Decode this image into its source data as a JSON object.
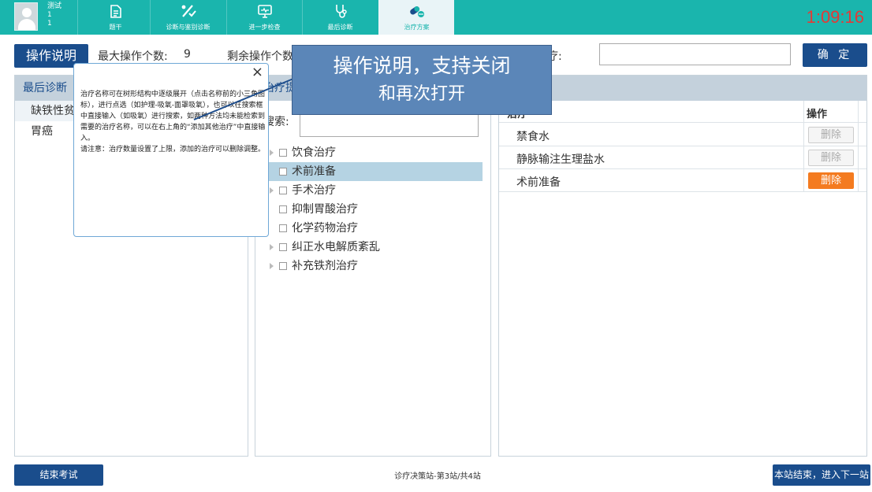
{
  "user": {
    "name": "测试",
    "line2": "1",
    "line3": "1"
  },
  "nav": [
    {
      "label": "题干",
      "icon": "document-icon",
      "active": false
    },
    {
      "label": "诊断与鉴别诊断",
      "icon": "percent-check-icon",
      "active": false
    },
    {
      "label": "进一步检查",
      "icon": "monitor-icon",
      "active": false
    },
    {
      "label": "最后诊断",
      "icon": "stethoscope-icon",
      "active": false
    },
    {
      "label": "治疗方案",
      "icon": "pills-icon",
      "active": true
    }
  ],
  "timer": "1:09:16",
  "ops": {
    "help_button": "操作说明",
    "max_label": "最大操作个数:",
    "max_value": "9",
    "remain_label": "剩余操作个数"
  },
  "add_other": {
    "label": "治疗:",
    "value": ""
  },
  "confirm_label": "确 定",
  "final_diag": {
    "title": "最后诊断",
    "items": [
      "缺铁性贫",
      "胃癌"
    ]
  },
  "treatment_tree": {
    "title": "治疗提",
    "search_label": "搜索:",
    "nodes": [
      {
        "label": "饮食治疗",
        "expandable": true,
        "selected": false
      },
      {
        "label": "术前准备",
        "expandable": false,
        "selected": true
      },
      {
        "label": "手术治疗",
        "expandable": true,
        "selected": false
      },
      {
        "label": "抑制胃酸治疗",
        "expandable": false,
        "selected": false
      },
      {
        "label": "化学药物治疗",
        "expandable": false,
        "selected": false
      },
      {
        "label": "纠正水电解质紊乱",
        "expandable": true,
        "selected": false
      },
      {
        "label": "补充铁剂治疗",
        "expandable": true,
        "selected": false
      }
    ]
  },
  "selected_table": {
    "name_header": "治疗",
    "op_header": "操作",
    "rows": [
      {
        "name": "禁食水",
        "action": "删除",
        "active": false
      },
      {
        "name": "静脉输注生理盐水",
        "action": "删除",
        "active": false
      },
      {
        "name": "术前准备",
        "action": "删除",
        "active": true
      }
    ]
  },
  "footer": {
    "end_exam": "结束考试",
    "station": "诊疗决策站-第3站/共4站",
    "next": "本站结束，进入下一站"
  },
  "help_popup": {
    "close": "×",
    "paragraphs": [
      "治疗名称可在树形结构中逐级展开（点击名称前的小三角图标），进行点选（如护理-吸氧-面罩吸氧），也可以在搜索框中直接输入（如吸氧）进行搜索，如两种方法均未能检索到需要的治疗名称，可以在右上角的“添加其他治疗”中直接输入。",
      "请注意：治疗数量设置了上限，添加的治疗可以删除调整。"
    ]
  },
  "callout": {
    "line1": "操作说明，支持关闭",
    "line2": "和再次打开"
  },
  "colors": {
    "teal": "#1ab5ad",
    "navy": "#1a4d8c",
    "orange": "#f47b20",
    "timer_red": "#e53935",
    "callout": "#5b86b8"
  }
}
